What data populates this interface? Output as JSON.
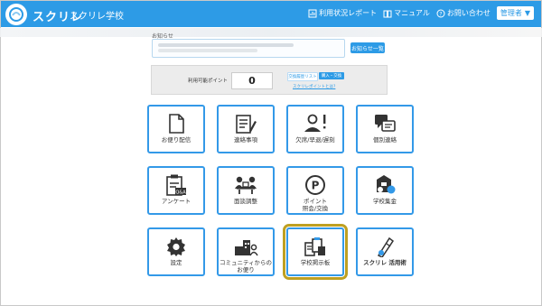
{
  "header": {
    "logo_text": "スクリレ",
    "school_name": "スクリレ学校",
    "links": [
      {
        "label": "利用状況レポート",
        "icon": "report-icon"
      },
      {
        "label": "マニュアル",
        "icon": "book-icon"
      },
      {
        "label": "お問い合わせ",
        "icon": "question-icon"
      }
    ],
    "logout_label": "管理者"
  },
  "notice": {
    "label": "お知らせ",
    "list_button": "お知らせ一覧"
  },
  "points": {
    "label": "利用可能ポイント",
    "value": "0",
    "btn_history": "交換履歴リスト",
    "btn_exchange": "購入・交換",
    "link": "スクリレポイントとは?"
  },
  "tiles": [
    {
      "label": "お便り配信",
      "icon": "document-icon"
    },
    {
      "label": "連絡事項",
      "icon": "notepad-pen-icon"
    },
    {
      "label": "欠席/早退/遅刻",
      "icon": "person-alert-icon"
    },
    {
      "label": "個別連絡",
      "icon": "chat-bubbles-icon"
    },
    {
      "label": "アンケート",
      "icon": "clipboard-qa-icon"
    },
    {
      "label": "面談調整",
      "icon": "meeting-icon"
    },
    {
      "label": "ポイント\n照会/交換",
      "icon": "point-coin-icon"
    },
    {
      "label": "学校集金",
      "icon": "coins-icon"
    },
    {
      "label": "設定",
      "icon": "gear-icon"
    },
    {
      "label": "コミュニティからの\nお便り",
      "icon": "community-icon"
    },
    {
      "label": "学校掲示板",
      "icon": "bulletin-board-icon"
    },
    {
      "label": "スクリレ 活用術",
      "icon": "tips-logo-icon"
    }
  ],
  "colors": {
    "primary": "#2d9be6",
    "highlight": "#bfa021"
  }
}
